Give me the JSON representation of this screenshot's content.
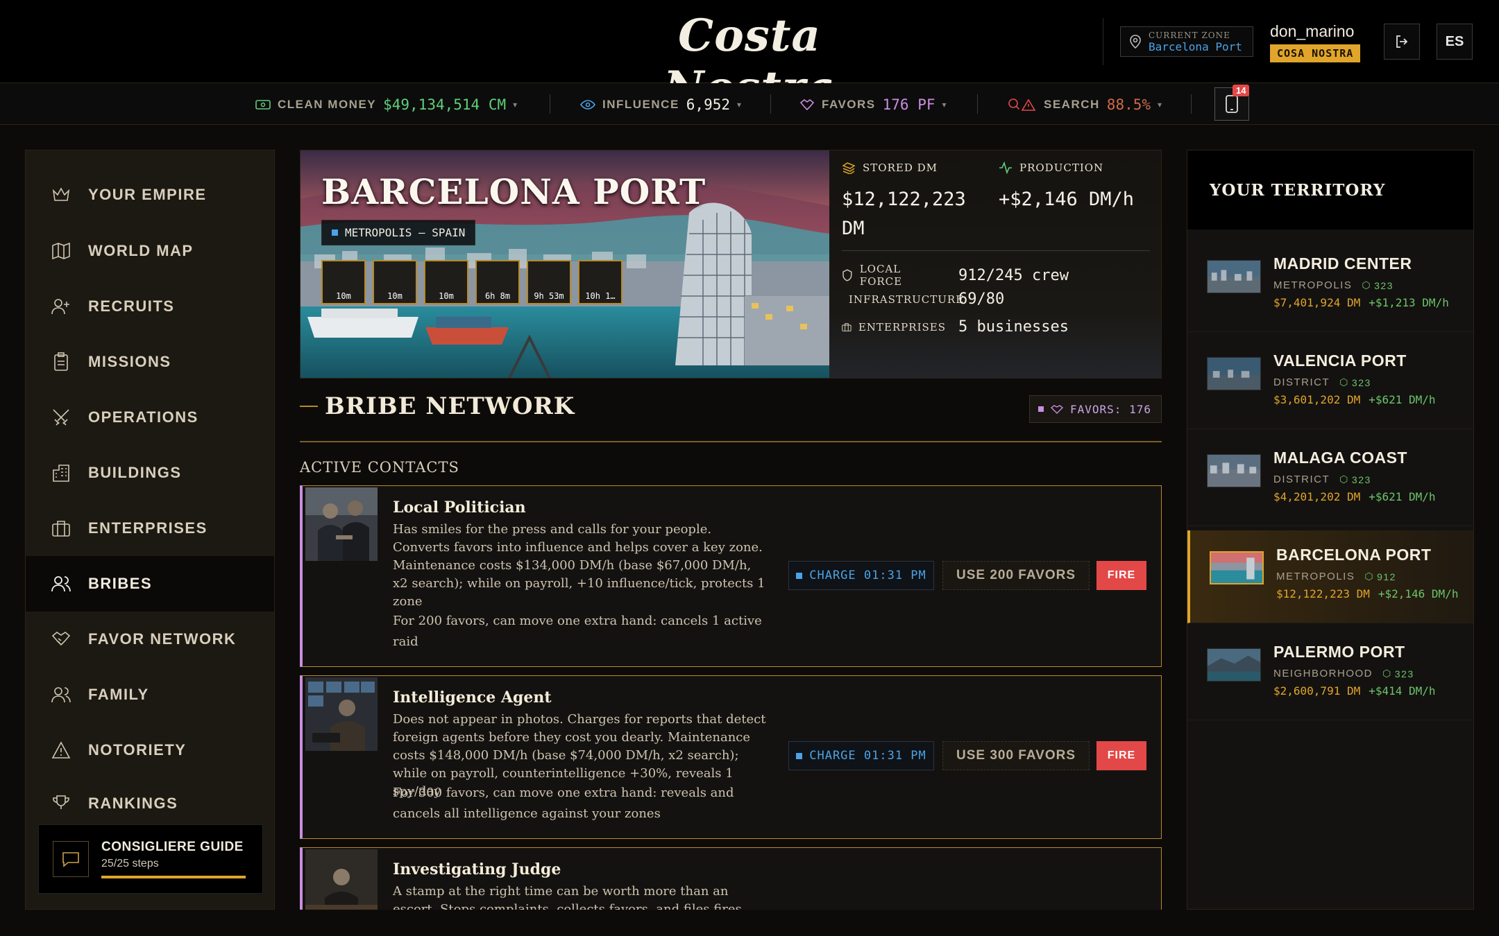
{
  "header": {
    "logo": "Costa Nostra",
    "zone_label": "CURRENT ZONE",
    "zone_value": "Barcelona Port",
    "username": "don_marino",
    "faction": "COSA NOSTRA",
    "logout_icon": "logout-icon",
    "language": "ES"
  },
  "stats": {
    "clean_money_label": "CLEAN MONEY",
    "clean_money_value": "$49,134,514 CM",
    "influence_label": "INFLUENCE",
    "influence_value": "6,952",
    "favors_label": "FAVORS",
    "favors_value": "176 PF",
    "search_label": "SEARCH",
    "search_value": "88.5%",
    "notifications": "14",
    "colors": {
      "money": "#5fcf7a",
      "favors": "#c98ee0",
      "search": "#e34848"
    }
  },
  "sidebar": {
    "items": [
      {
        "label": "YOUR EMPIRE",
        "icon": "crown-icon"
      },
      {
        "label": "WORLD MAP",
        "icon": "map-icon"
      },
      {
        "label": "RECRUITS",
        "icon": "user-plus-icon"
      },
      {
        "label": "MISSIONS",
        "icon": "clipboard-icon"
      },
      {
        "label": "OPERATIONS",
        "icon": "swords-icon"
      },
      {
        "label": "BUILDINGS",
        "icon": "building-icon"
      },
      {
        "label": "ENTERPRISES",
        "icon": "briefcase-icon"
      },
      {
        "label": "BRIBES",
        "icon": "users-icon",
        "active": true
      },
      {
        "label": "FAVOR NETWORK",
        "icon": "handshake-icon"
      },
      {
        "label": "FAMILY",
        "icon": "family-icon"
      },
      {
        "label": "NOTORIETY",
        "icon": "warning-icon"
      },
      {
        "label": "RANKINGS",
        "icon": "trophy-icon"
      }
    ],
    "guide": {
      "title": "CONSIGLIERE GUIDE",
      "steps": "25/25 steps",
      "progress": 1.0
    }
  },
  "hero": {
    "title": "BARCELONA PORT",
    "tag": "METROPOLIS — SPAIN",
    "timers": [
      "10m",
      "10m",
      "10m",
      "6h 8m",
      "9h 53m",
      "10h 1…"
    ],
    "stored_label": "STORED DM",
    "stored_value_line1": "$12,122,223",
    "stored_value_line2": "DM",
    "production_label": "PRODUCTION",
    "production_value": "+$2,146 DM/h",
    "local_force_label": "LOCAL FORCE",
    "local_force_value": "912/245 crew",
    "infrastructure_label": "INFRASTRUCTURE",
    "infrastructure_value": "69/80",
    "enterprises_label": "ENTERPRISES",
    "enterprises_value": "5 businesses"
  },
  "bribes": {
    "title": "BRIBE NETWORK",
    "favors_pill": "FAVORS: 176",
    "subtitle": "ACTIVE CONTACTS",
    "cards": [
      {
        "name": "Local Politician",
        "desc": "Has smiles for the press and calls for your people. Converts favors into influence and helps cover a key zone. Maintenance costs $134,000 DM/h (base $67,000 DM/h, x2 search); while on payroll, +10 influence/tick, protects 1 zone",
        "extra": "For 200 favors, can move one extra hand: cancels 1 active raid",
        "charge": "CHARGE 01:31 PM",
        "use": "USE 200 FAVORS",
        "fire": "FIRE"
      },
      {
        "name": "Intelligence Agent",
        "desc": "Does not appear in photos. Charges for reports that detect foreign agents before they cost you dearly. Maintenance costs $148,000 DM/h (base $74,000 DM/h, x2 search); while on payroll, counterintelligence +30%, reveals 1 spy/day",
        "extra": "For 300 favors, can move one extra hand: reveals and cancels all intelligence against your zones",
        "charge": "CHARGE 01:31 PM",
        "use": "USE 300 FAVORS",
        "fire": "FIRE"
      },
      {
        "name": "Investigating Judge",
        "desc": "A stamp at the right time can be worth more than an escort. Stops complaints, collects favors, and files fires"
      }
    ]
  },
  "territory": {
    "title": "YOUR TERRITORY",
    "items": [
      {
        "name": "MADRID CENTER",
        "type": "METROPOLIS",
        "crew": "323",
        "money": "$7,401,924 DM",
        "rate": "+$1,213 DM/h"
      },
      {
        "name": "VALENCIA PORT",
        "type": "DISTRICT",
        "crew": "323",
        "money": "$3,601,202 DM",
        "rate": "+$621 DM/h"
      },
      {
        "name": "MALAGA COAST",
        "type": "DISTRICT",
        "crew": "323",
        "money": "$4,201,202 DM",
        "rate": "+$621 DM/h"
      },
      {
        "name": "BARCELONA PORT",
        "type": "METROPOLIS",
        "crew": "912",
        "money": "$12,122,223 DM",
        "rate": "+$2,146 DM/h",
        "active": true
      },
      {
        "name": "PALERMO PORT",
        "type": "NEIGHBORHOOD",
        "crew": "323",
        "money": "$2,600,791 DM",
        "rate": "+$414 DM/h"
      }
    ]
  }
}
